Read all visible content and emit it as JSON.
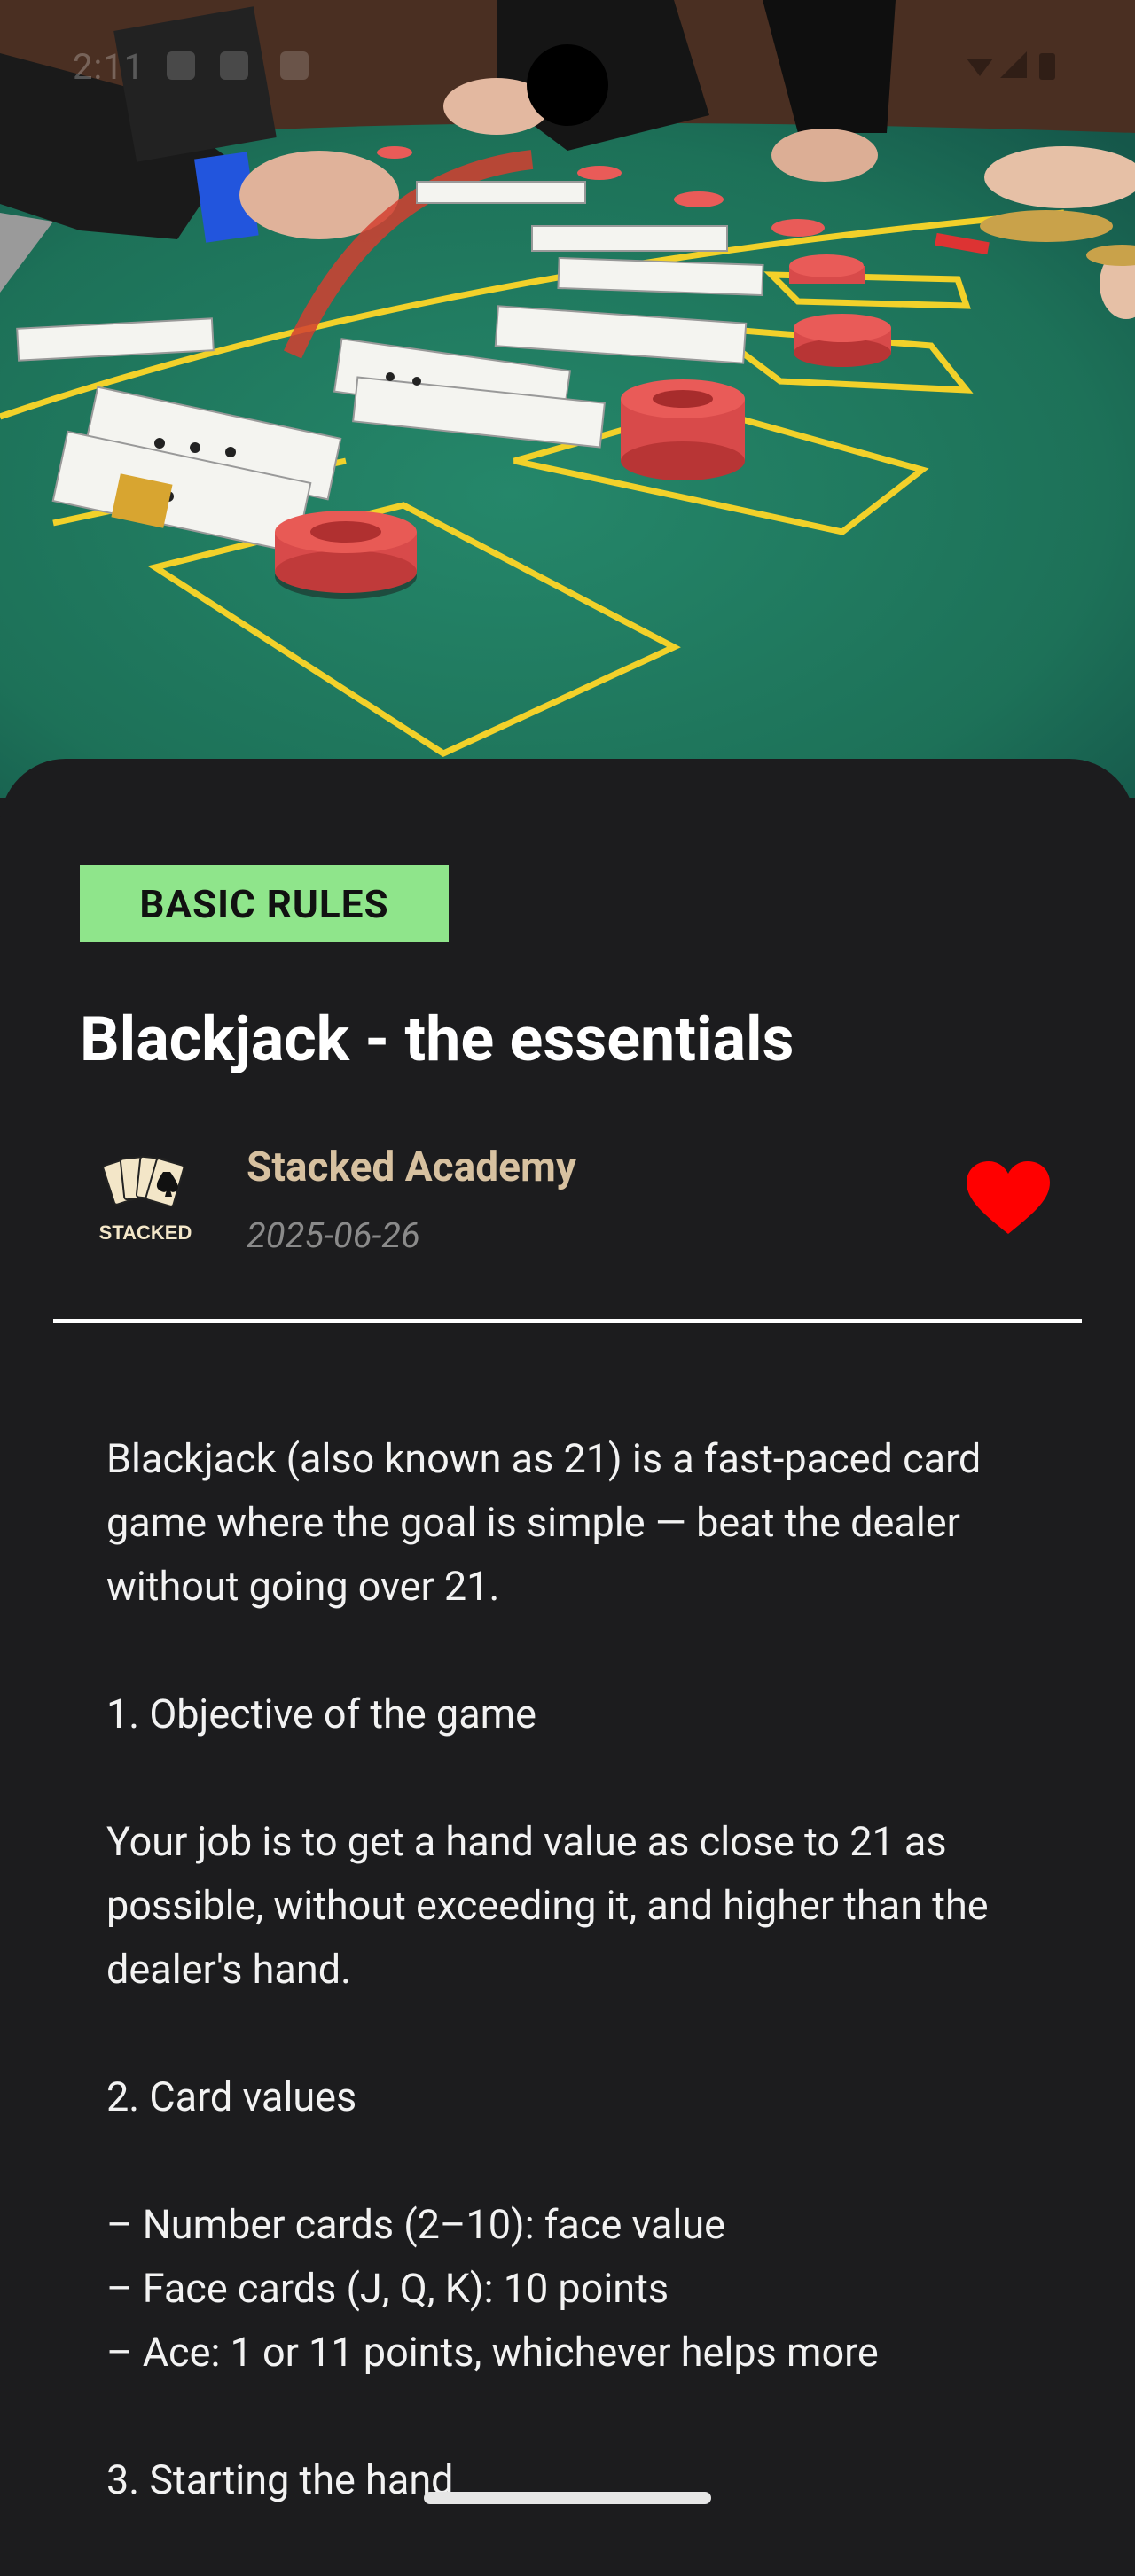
{
  "status_bar": {
    "time": "2:11"
  },
  "article": {
    "category_badge": "BASIC RULES",
    "title": "Blackjack - the essentials",
    "author": {
      "name": "Stacked Academy",
      "logo_text": "STACKED",
      "date": "2025-06-26"
    },
    "favorite_icon": "heart-icon",
    "body": {
      "intro": "Blackjack (also known as 21) is a fast-paced card game where the goal is simple — beat the dealer without going over 21.",
      "section1_heading": "1. Objective of the game",
      "section1_text": "Your job is to get a hand value as close to 21 as possible, without exceeding it, and higher than the dealer's hand.",
      "section2_heading": "2. Card values",
      "card_values": [
        "– Number cards (2–10): face value",
        "– Face cards (J, Q, K): 10 points",
        "– Ace: 1 or 11 points, whichever helps more"
      ],
      "section3_heading": "3. Starting the hand"
    }
  },
  "colors": {
    "background": "#1c1c1e",
    "badge": "#8fe58b",
    "author_name": "#d7c1a0",
    "date": "#8a8a8a",
    "heart": "#ff0000",
    "felt": "#1e7a5e"
  }
}
